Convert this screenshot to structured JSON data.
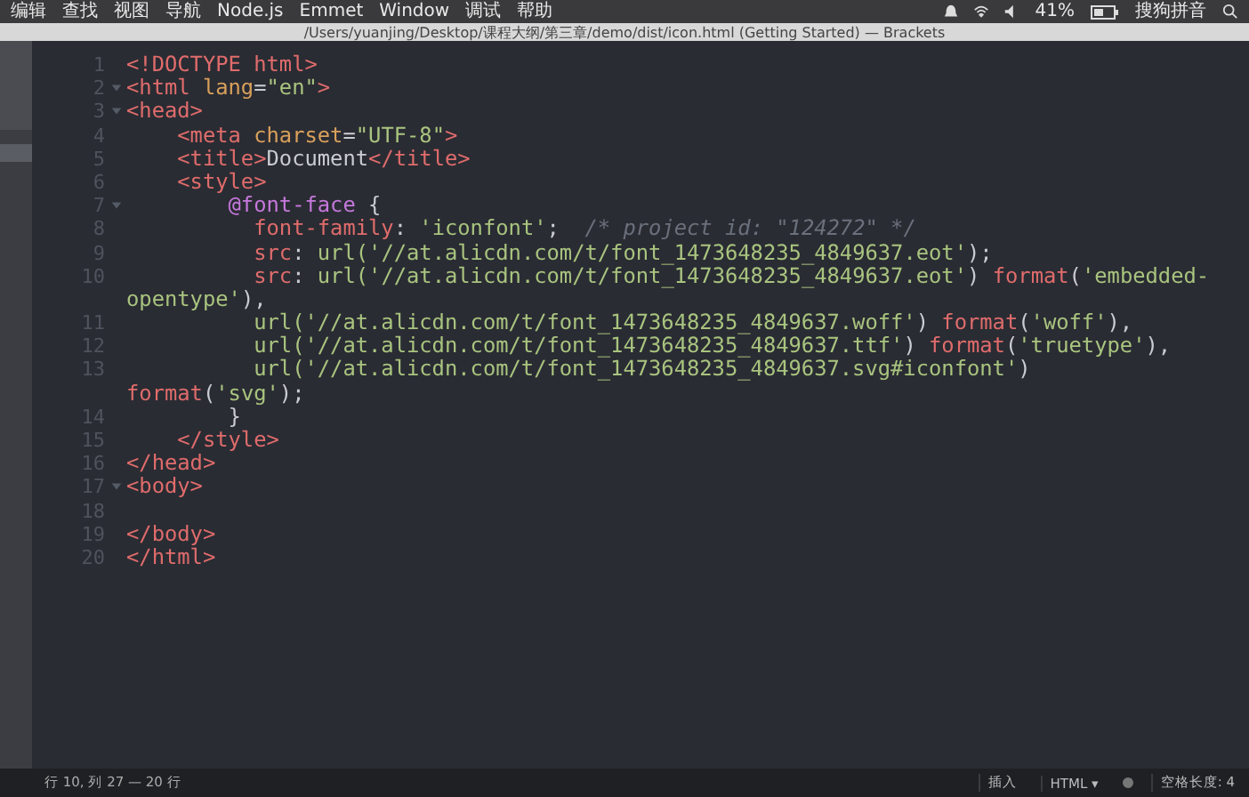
{
  "menu_bar": {
    "items": [
      "编辑",
      "查找",
      "视图",
      "导航",
      "Node.js",
      "Emmet",
      "Window",
      "调试",
      "帮助"
    ],
    "battery": "41%",
    "input_method": "搜狗拼音"
  },
  "window": {
    "title": "/Users/yuanjing/Desktop/课程大纲/第三章/demo/dist/icon.html (Getting Started) — Brackets"
  },
  "editor": {
    "lines": [
      {
        "number": "1",
        "tokens": [
          {
            "kind": "tag",
            "text": "<!DOCTYPE html>"
          }
        ]
      },
      {
        "number": "2",
        "expanded": true,
        "tokens": [
          {
            "kind": "tag",
            "text": "<html"
          },
          {
            "kind": "attr",
            "text": " lang"
          },
          {
            "kind": "plain",
            "text": "="
          },
          {
            "kind": "string",
            "text": "\"en\""
          },
          {
            "kind": "tag",
            "text": ">"
          }
        ]
      },
      {
        "number": "3",
        "expanded": true,
        "tokens": [
          {
            "kind": "tag",
            "text": "<head>"
          }
        ]
      },
      {
        "number": "4",
        "tokens": [
          {
            "kind": "tag",
            "text": "    <meta"
          },
          {
            "kind": "attr",
            "text": " charset"
          },
          {
            "kind": "plain",
            "text": "="
          },
          {
            "kind": "string",
            "text": "\"UTF-8\""
          },
          {
            "kind": "tag",
            "text": ">"
          }
        ]
      },
      {
        "number": "5",
        "tokens": [
          {
            "kind": "tag",
            "text": "    <title>"
          },
          {
            "kind": "plain",
            "text": "Document"
          },
          {
            "kind": "tag",
            "text": "</title>"
          }
        ]
      },
      {
        "number": "6",
        "tokens": [
          {
            "kind": "tag",
            "text": "    <style>"
          }
        ]
      },
      {
        "number": "7",
        "expanded": true,
        "tokens": [
          {
            "kind": "at",
            "text": "        @font-face"
          },
          {
            "kind": "plain",
            "text": " {"
          }
        ]
      },
      {
        "number": "8",
        "tokens": [
          {
            "kind": "prop",
            "text": "          font-family"
          },
          {
            "kind": "plain",
            "text": ": "
          },
          {
            "kind": "string",
            "text": "'iconfont'"
          },
          {
            "kind": "plain",
            "text": ";  "
          },
          {
            "kind": "comment",
            "text": "/* project id: \"124272\" */"
          }
        ]
      },
      {
        "number": "9",
        "tokens": [
          {
            "kind": "prop",
            "text": "          src"
          },
          {
            "kind": "plain",
            "text": ": "
          },
          {
            "kind": "string",
            "text": "url('//at.alicdn.com/t/font_1473648235_4849637.eot'"
          },
          {
            "kind": "plain",
            "text": ");"
          }
        ]
      },
      {
        "number": "10",
        "tokens": [
          {
            "kind": "prop",
            "text": "          src"
          },
          {
            "kind": "plain",
            "text": ": "
          },
          {
            "kind": "string",
            "text": "url('//at.alicdn.com/t/font_1473648235_4849637.eot'"
          },
          {
            "kind": "plain",
            "text": ") "
          },
          {
            "kind": "prop",
            "text": "format"
          },
          {
            "kind": "plain",
            "text": "("
          },
          {
            "kind": "string",
            "text": "'embedded-"
          }
        ]
      },
      {
        "tokens": [
          {
            "kind": "string",
            "text": "opentype'"
          },
          {
            "kind": "plain",
            "text": "),"
          }
        ]
      },
      {
        "number": "11",
        "tokens": [
          {
            "kind": "string",
            "text": "          url('//at.alicdn.com/t/font_1473648235_4849637.woff'"
          },
          {
            "kind": "plain",
            "text": ") "
          },
          {
            "kind": "prop",
            "text": "format"
          },
          {
            "kind": "plain",
            "text": "("
          },
          {
            "kind": "string",
            "text": "'woff'"
          },
          {
            "kind": "plain",
            "text": "),"
          }
        ]
      },
      {
        "number": "12",
        "tokens": [
          {
            "kind": "string",
            "text": "          url('//at.alicdn.com/t/font_1473648235_4849637.ttf'"
          },
          {
            "kind": "plain",
            "text": ") "
          },
          {
            "kind": "prop",
            "text": "format"
          },
          {
            "kind": "plain",
            "text": "("
          },
          {
            "kind": "string",
            "text": "'truetype'"
          },
          {
            "kind": "plain",
            "text": "),"
          }
        ]
      },
      {
        "number": "13",
        "tokens": [
          {
            "kind": "string",
            "text": "          url('//at.alicdn.com/t/font_1473648235_4849637.svg#iconfont'"
          },
          {
            "kind": "plain",
            "text": ")"
          }
        ]
      },
      {
        "tokens": [
          {
            "kind": "prop",
            "text": "format"
          },
          {
            "kind": "plain",
            "text": "("
          },
          {
            "kind": "string",
            "text": "'svg'"
          },
          {
            "kind": "plain",
            "text": ");"
          }
        ]
      },
      {
        "number": "14",
        "tokens": [
          {
            "kind": "plain",
            "text": "        }"
          }
        ]
      },
      {
        "number": "15",
        "tokens": [
          {
            "kind": "tag",
            "text": "    </style>"
          }
        ]
      },
      {
        "number": "16",
        "tokens": [
          {
            "kind": "tag",
            "text": "</head>"
          }
        ]
      },
      {
        "number": "17",
        "expanded": true,
        "tokens": [
          {
            "kind": "tag",
            "text": "<body>"
          }
        ]
      },
      {
        "number": "18"
      },
      {
        "number": "19",
        "tokens": [
          {
            "kind": "tag",
            "text": "</body>"
          }
        ]
      },
      {
        "number": "20",
        "tokens": [
          {
            "kind": "tag",
            "text": "</html>"
          }
        ]
      }
    ]
  },
  "status_bar": {
    "cursor": "行 10, 列 27 — 20 行",
    "mode": "插入",
    "language": "HTML ▾",
    "indent": "空格长度: 4"
  }
}
